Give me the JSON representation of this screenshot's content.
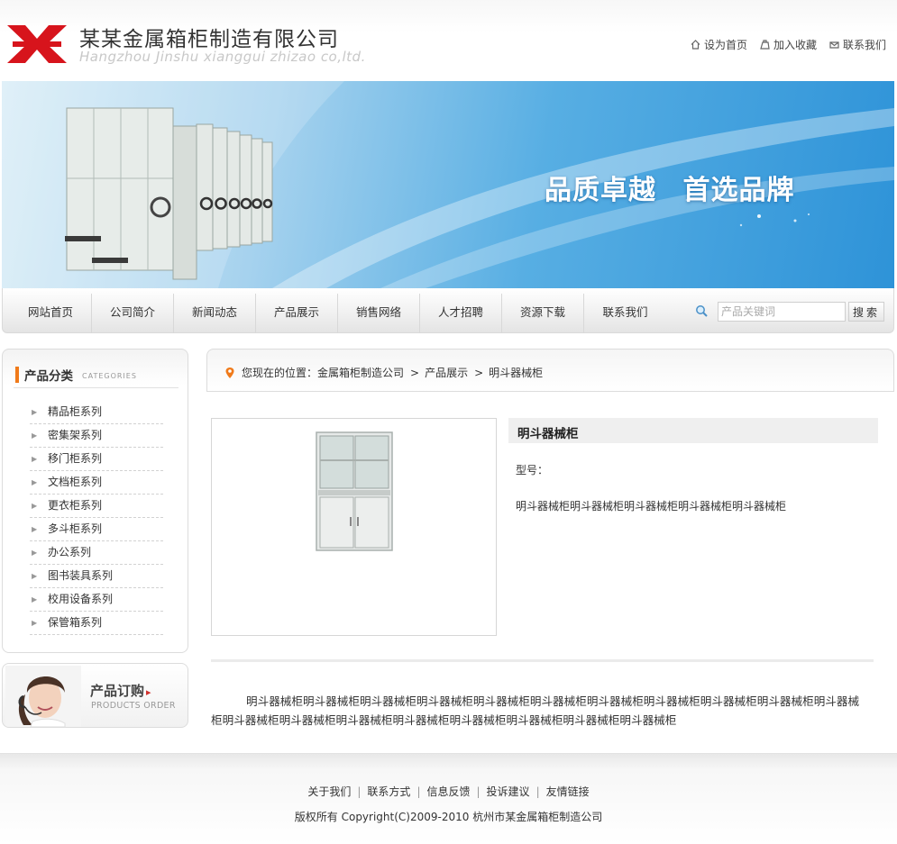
{
  "header": {
    "company_name": "某某金属箱柜制造有限公司",
    "company_name_en": "Hangzhou Jinshu xianggui zhizao co,ltd.",
    "top_links": [
      {
        "label": "设为首页",
        "icon": "home-icon"
      },
      {
        "label": "加入收藏",
        "icon": "bookmark-icon"
      },
      {
        "label": "联系我们",
        "icon": "contact-icon"
      }
    ],
    "brand_color": "#d7141c"
  },
  "banner": {
    "slogan": "品质卓越 首选品牌",
    "bg_color": "#3a9be0"
  },
  "nav": {
    "items": [
      "网站首页",
      "公司简介",
      "新闻动态",
      "产品展示",
      "销售网络",
      "人才招聘",
      "资源下载",
      "联系我们"
    ],
    "search_placeholder": "产品关键词",
    "search_button": "搜索"
  },
  "sidebar": {
    "category_title": "产品分类",
    "category_subtitle": "CATEGORIES",
    "categories": [
      "精品柜系列",
      "密集架系列",
      "移门柜系列",
      "文档柜系列",
      "更衣柜系列",
      "多斗柜系列",
      "办公系列",
      "图书装具系列",
      "校用设备系列",
      "保管箱系列"
    ],
    "order_title": "产品订购",
    "order_subtitle": "PRODUCTS ORDER",
    "accent_color": "#f07a1a"
  },
  "breadcrumb": {
    "prefix": "您现在的位置：",
    "items": [
      "金属箱柜制造公司",
      "产品展示",
      "明斗器械柜"
    ],
    "separator": ">"
  },
  "product": {
    "title": "明斗器械柜",
    "model_label": "型号：",
    "model_value": "",
    "short_description": "明斗器械柜明斗器械柜明斗器械柜明斗器械柜明斗器械柜",
    "description": "明斗器械柜明斗器械柜明斗器械柜明斗器械柜明斗器械柜明斗器械柜明斗器械柜明斗器械柜明斗器械柜明斗器械柜明斗器械柜明斗器械柜明斗器械柜明斗器械柜明斗器械柜明斗器械柜明斗器械柜明斗器械柜明斗器械柜"
  },
  "footer": {
    "links": [
      "关于我们",
      "联系方式",
      "信息反馈",
      "投诉建议",
      "友情链接"
    ],
    "copyright": "版权所有  Copyright(C)2009-2010 杭州市某金属箱柜制造公司"
  }
}
